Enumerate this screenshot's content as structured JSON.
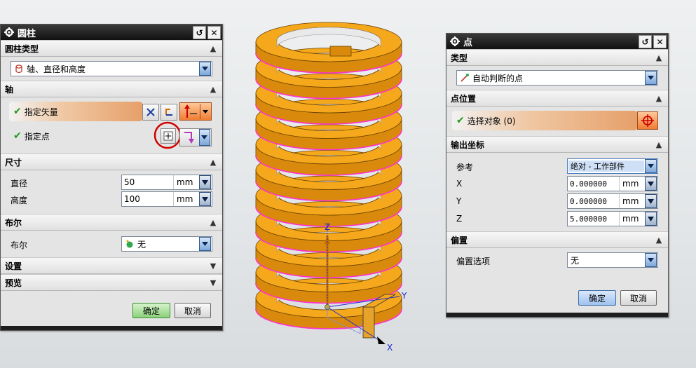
{
  "cylinder_dialog": {
    "title": "圆柱",
    "sections": {
      "type": {
        "title": "圆柱类型",
        "dropdown_value": "轴、直径和高度"
      },
      "axis": {
        "title": "轴",
        "specify_vector": "指定矢量",
        "specify_point": "指定点"
      },
      "dimensions": {
        "title": "尺寸",
        "diameter_label": "直径",
        "diameter_value": "50",
        "diameter_unit": "mm",
        "height_label": "高度",
        "height_value": "100",
        "height_unit": "mm"
      },
      "boolean": {
        "title": "布尔",
        "label": "布尔",
        "value": "无"
      },
      "settings": {
        "title": "设置"
      },
      "preview": {
        "title": "预览"
      }
    },
    "ok_label": "确定",
    "cancel_label": "取消"
  },
  "point_dialog": {
    "title": "点",
    "sections": {
      "type": {
        "title": "类型",
        "dropdown_value": "自动判断的点"
      },
      "location": {
        "title": "点位置",
        "select_object": "选择对象 (0)"
      },
      "output": {
        "title": "输出坐标",
        "reference_label": "参考",
        "reference_value": "绝对 - 工作部件",
        "x_label": "X",
        "x_value": "0.000000",
        "x_unit": "mm",
        "y_label": "Y",
        "y_value": "0.000000",
        "y_unit": "mm",
        "z_label": "Z",
        "z_value": "5.000000",
        "z_unit": "mm"
      },
      "offset": {
        "title": "偏置",
        "label": "偏置选项",
        "value": "无"
      }
    },
    "ok_label": "确定",
    "cancel_label": "取消"
  },
  "viewport": {
    "axis_x": "X",
    "axis_y": "Y",
    "axis_z": "Z",
    "spring_color": "#f5a81b",
    "edge_color": "#ff33cc"
  },
  "colors": {
    "titlebar": "#1a1a1a",
    "highlight_orange": "#ef7d33",
    "check_green": "#1a9a1a",
    "annotation_red": "#d10000"
  }
}
